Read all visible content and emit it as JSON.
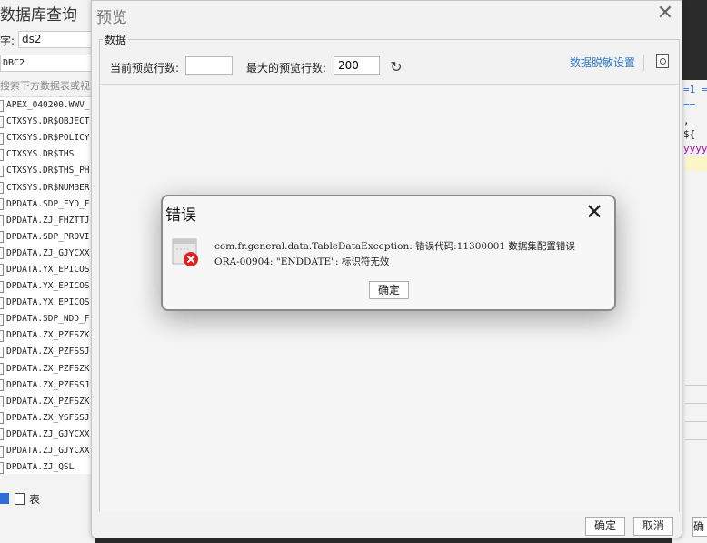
{
  "background_left": {
    "title": "数据库查询",
    "datasource_label": "字:",
    "datasource_value": "ds2",
    "connection_value": "DBC2",
    "search_placeholder": "搜索下方数据表或视图",
    "tables": [
      "APEX_040200.WWV_",
      "CTXSYS.DR$OBJECT",
      "CTXSYS.DR$POLICY",
      "CTXSYS.DR$THS",
      "CTXSYS.DR$THS_PH",
      "CTXSYS.DR$NUMBER",
      "DPDATA.SDP_FYD_F",
      "DPDATA.ZJ_FHZTTJ",
      "DPDATA.SDP_PROVI",
      "DPDATA.ZJ_GJYCXX",
      "DPDATA.YX_EPICOS",
      "DPDATA.YX_EPICOS",
      "DPDATA.YX_EPICOS",
      "DPDATA.SDP_NDD_F",
      "DPDATA.ZX_PZFSZK",
      "DPDATA.ZX_PZFSSJ",
      "DPDATA.ZX_PZFSZK",
      "DPDATA.ZX_PZFSSJ",
      "DPDATA.ZX_PZFSZK",
      "DPDATA.ZX_YSFSSJ",
      "DPDATA.ZJ_GJYCXX",
      "DPDATA.ZJ_GJYCXX",
      "DPDATA.ZJ_QSL"
    ],
    "table_type_label": "表"
  },
  "background_right": {
    "code_lines": [
      "=1 =",
      " ==",
      ",",
      " ${",
      "yyyy"
    ],
    "button_label": "确"
  },
  "preview_dialog": {
    "title": "预览",
    "group_label": "数据",
    "current_rows_label": "当前预览行数:",
    "current_rows_value": "",
    "max_rows_label": "最大的预览行数:",
    "max_rows_value": "200",
    "desensitize_link": "数据脱敏设置",
    "confirm_label": "确定",
    "cancel_label": "取消"
  },
  "error_dialog": {
    "title": "错误",
    "message_line1": "com.fr.general.data.TableDataException: 错误代码:11300001 数据集配置错误",
    "message_line2": "ORA-00904: \"ENDDATE\": 标识符无效",
    "ok_label": "确定"
  },
  "colors": {
    "link": "#2f79c7",
    "error_red": "#e02020",
    "accent_blue": "#2d6fd6",
    "code_purple": "#b000b0"
  }
}
